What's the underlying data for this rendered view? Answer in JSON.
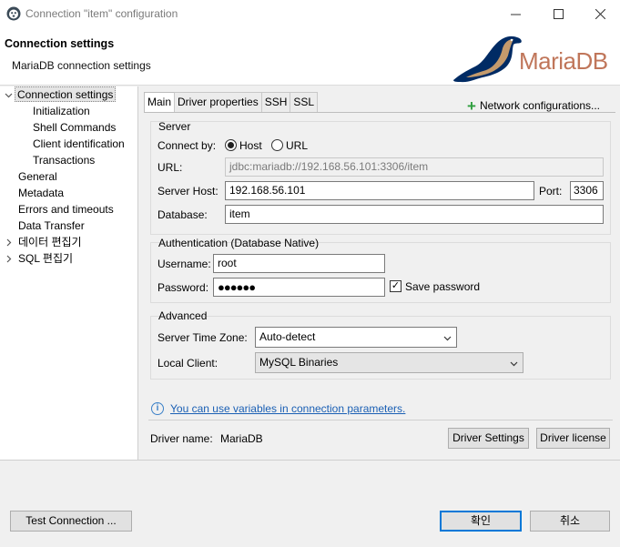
{
  "window": {
    "title": "Connection \"item\" configuration",
    "minimize_glyph": "—",
    "maximize_glyph": "☐",
    "close_glyph": "✕"
  },
  "header": {
    "title": "Connection settings",
    "subtitle": "MariaDB connection settings",
    "logo_text": "MariaDB"
  },
  "tree": {
    "items": [
      {
        "label": "Connection settings",
        "expanded": true
      },
      {
        "label": "Initialization"
      },
      {
        "label": "Shell Commands"
      },
      {
        "label": "Client identification"
      },
      {
        "label": "Transactions"
      },
      {
        "label": "General"
      },
      {
        "label": "Metadata"
      },
      {
        "label": "Errors and timeouts"
      },
      {
        "label": "Data Transfer"
      },
      {
        "label": "데이터 편집기",
        "expanded": false
      },
      {
        "label": "SQL 편집기",
        "expanded": false
      }
    ]
  },
  "tabs": [
    "Main",
    "Driver properties",
    "SSH",
    "SSL"
  ],
  "network_configurations": "Network configurations...",
  "server": {
    "group_title": "Server",
    "connect_by_label": "Connect by:",
    "host_option": "Host",
    "url_option": "URL",
    "selected": "Host",
    "url_label": "URL:",
    "url_value": "jdbc:mariadb://192.168.56.101:3306/item",
    "server_host_label": "Server Host:",
    "server_host_value": "192.168.56.101",
    "port_label": "Port:",
    "port_value": "3306",
    "database_label": "Database:",
    "database_value": "item"
  },
  "auth": {
    "group_title": "Authentication (Database Native)",
    "username_label": "Username:",
    "username_value": "root",
    "password_label": "Password:",
    "password_value": "●●●●●●",
    "save_password_label": "Save password",
    "save_password_checked": true
  },
  "advanced": {
    "group_title": "Advanced",
    "timezone_label": "Server Time Zone:",
    "timezone_value": "Auto-detect",
    "local_client_label": "Local Client:",
    "local_client_value": "MySQL Binaries"
  },
  "info_link": "You can use variables in connection parameters.",
  "driver": {
    "name_label": "Driver name:",
    "name_value": "MariaDB",
    "settings_button": "Driver Settings",
    "license_button": "Driver license"
  },
  "footer": {
    "test_connection": "Test Connection ...",
    "ok": "확인",
    "cancel": "취소"
  },
  "colors": {
    "accent": "#0078d7",
    "link": "#1a5fb4",
    "logo": "#c0765a",
    "plus": "#2e9e3e"
  }
}
